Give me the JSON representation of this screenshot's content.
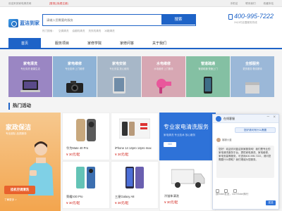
{
  "topbar": {
    "welcome": "欢迎来到家电清洗网",
    "login": "[登录] [免费注册]",
    "links": [
      "手机站",
      "联系我们",
      "收藏本站"
    ]
  },
  "header": {
    "logo_text": "蓝洁到家",
    "search_placeholder": "请输入您需要的服务",
    "search_button": "搜索",
    "hot_links": [
      "热门搜索：",
      "空调清洗",
      "油烟机清洗",
      "洗衣机清洗",
      "冰箱清洗"
    ],
    "phone": "400-995-7222",
    "phone_sub": "24小时全国服务热线"
  },
  "nav": {
    "items": [
      {
        "label": "首页",
        "active": true
      },
      {
        "label": "服务项目",
        "active": false
      },
      {
        "label": "家修学院",
        "active": false
      },
      {
        "label": "家修问答",
        "active": false
      },
      {
        "label": "关于我们",
        "active": false
      }
    ]
  },
  "categories": [
    {
      "title": "家电清洗",
      "sub": "专业清洗 健康生活",
      "color": "#9a86c3",
      "icon": "laptop-icon"
    },
    {
      "title": "家电维修",
      "sub": "专业技师 上门维修",
      "color": "#8fb3d6",
      "icon": "camera-icon"
    },
    {
      "title": "家电安装",
      "sub": "专业安装 放心使用",
      "color": "#a7b7c8",
      "icon": "tablet-icon"
    },
    {
      "title": "水电维修",
      "sub": "水电维修 上门服务",
      "color": "#d7a7b3",
      "icon": "hairdryer-icon"
    },
    {
      "title": "管道疏通",
      "sub": "管道疏通 快速上门",
      "color": "#84c0a3",
      "icon": "phone-icon"
    },
    {
      "title": "全部服务",
      "sub": "更多服务 敬请期待",
      "color": "#9bb8d8",
      "icon": "box-icon"
    }
  ],
  "section_title": "热门活动",
  "promo": {
    "title": "家政保洁",
    "sub": "专业团队 品质服务",
    "tag": "挂机空调清洗",
    "more": "了解更多 >"
  },
  "products": [
    {
      "name": "华为Mate 40 Pro",
      "price": "¥ 30元/起"
    },
    {
      "name": "iPhone 14 14pro 14pro max",
      "price": "¥ 30元/起"
    },
    {
      "name": "荣耀V30 Pro",
      "price": "¥ 30元/起"
    },
    {
      "name": "三星Galaxy A8",
      "price": "¥ 30元/起"
    }
  ],
  "banner": {
    "title": "专业家电清洗服务",
    "sub": "家电清洗 专业技术 放心服务",
    "go": "GO"
  },
  "truck": {
    "name": "冷链车清洗",
    "price": "¥ 30元/起"
  },
  "chat": {
    "name": "在线客服",
    "user_msg": "您好请问有什么需要",
    "agent": "客服小蓝",
    "agent_msg": "您好！欢迎访问蓝洁到家服务网！我们是专业的家电清洗服务平台，提供家电清洗、家电维修、家电安装等服务，可咨询400-995-7222，请问您需要什么帮助？我们竭诚为您服务。",
    "input_placeholder": "按Enter发送，Ctrl+Enter换行",
    "send": "发送"
  }
}
